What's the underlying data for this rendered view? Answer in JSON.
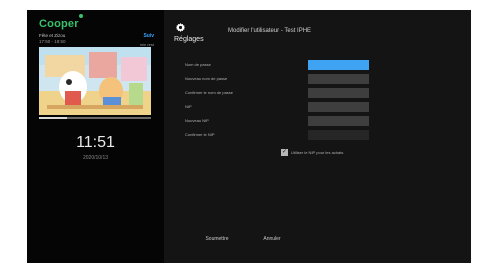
{
  "sidebar": {
    "channel_logo": "Cooper",
    "live_label": "Suiv",
    "program_title": "Fête et Zizou",
    "program_time": "17:50 - 18:50",
    "remaining": "min rest",
    "progress_fraction": 0.25,
    "clock": "11:51",
    "date": "2020/10/13"
  },
  "header": {
    "settings_title": "Réglages",
    "page_title": "Modifier l'utilisateur - Test IPHE"
  },
  "form": {
    "fields": [
      {
        "label": "Nom de passe",
        "state": "focused"
      },
      {
        "label": "Nouveau nom de passe",
        "state": "normal"
      },
      {
        "label": "Confirmer le nom de passe",
        "state": "normal"
      },
      {
        "label": "NIP",
        "state": "normal"
      },
      {
        "label": "Nouveau NIP",
        "state": "normal"
      },
      {
        "label": "Confirmer le NIP",
        "state": "dim"
      }
    ],
    "checkbox_label": "Utiliser le NIP pour les achats",
    "checkbox_checked": true
  },
  "buttons": {
    "submit": "Soumettre",
    "cancel": "Annuler"
  },
  "icons": [
    "gear-icon",
    "checkmark-icon"
  ],
  "colors": {
    "accent_blue": "#3da3f2",
    "logo_green": "#39c06b"
  }
}
